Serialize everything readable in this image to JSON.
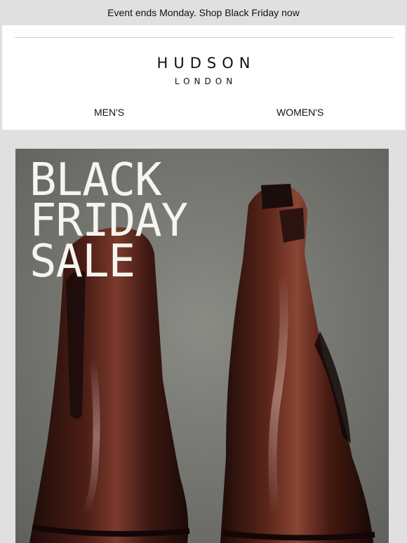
{
  "announcement": {
    "text": "Event ends Monday. Shop Black Friday now"
  },
  "brand": {
    "name": "HUDSON",
    "sub": "LONDON"
  },
  "nav": {
    "men": "MEN'S",
    "women": "WOMEN'S"
  },
  "hero": {
    "line1": "BLACK",
    "line2": "FRIDAY",
    "line3": "SALE",
    "image_alt": "Pair of dark brown polished leather Chelsea boots on a grey floor"
  },
  "colors": {
    "page_bg": "#e0e0e0",
    "header_bg": "#ffffff",
    "text": "#111111",
    "hero_text": "#f6f4ee",
    "boot_leather": "#4a2018"
  }
}
